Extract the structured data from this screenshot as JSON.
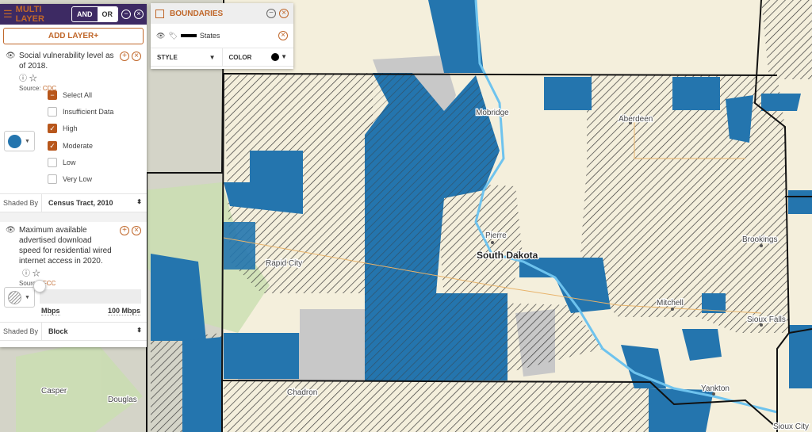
{
  "colors": {
    "accent": "#c0672a",
    "header": "#3d2a63",
    "blue_fill": "#2475ae",
    "hatch": "#3b3b3b",
    "gray": "#c8c8c8",
    "base": "#f4efdc"
  },
  "multi_layer": {
    "title": "MULTI LAYER",
    "icon": "layers-icon",
    "and_label": "AND",
    "or_label": "OR",
    "selected": "OR",
    "add_layer": "ADD LAYER+",
    "layers": [
      {
        "title": "Social vulnerability level as of 2018.",
        "source_label": "Source:",
        "source": "CDC",
        "legend_style": "blue-dot",
        "options": [
          {
            "label": "Select All",
            "state": "indeterminate"
          },
          {
            "label": "Insufficient Data",
            "state": "unchecked"
          },
          {
            "label": "High",
            "state": "checked"
          },
          {
            "label": "Moderate",
            "state": "checked"
          },
          {
            "label": "Low",
            "state": "unchecked"
          },
          {
            "label": "Very Low",
            "state": "unchecked"
          }
        ],
        "shaded_by_label": "Shaded By",
        "shaded_by": "Census Tract, 2010"
      },
      {
        "title": "Maximum available advertised download speed for residential wired internet access in 2020.",
        "source_label": "Source:",
        "source": "FCC",
        "legend_style": "hatched",
        "slider_min_label": "Mbps",
        "slider_max_label": "100 Mbps",
        "slider_value_fraction": 0,
        "shaded_by_label": "Shaded By",
        "shaded_by": "Block"
      }
    ]
  },
  "boundaries": {
    "title": "BOUNDARIES",
    "layer": "States",
    "style_label": "STYLE",
    "color_label": "COLOR",
    "color": "#000000"
  },
  "map_labels": {
    "mobridge": "Mobridge",
    "aberdeen": "Aberdeen",
    "pierre": "Pierre",
    "state": "South Dakota",
    "rapid_city": "Rapid City",
    "brookings": "Brookings",
    "mitchell": "Mitchell",
    "sioux_falls": "Sioux Falls",
    "yankton": "Yankton",
    "chadron": "Chadron",
    "casper": "Casper",
    "douglas": "Douglas",
    "sioux_city": "Sioux City"
  }
}
